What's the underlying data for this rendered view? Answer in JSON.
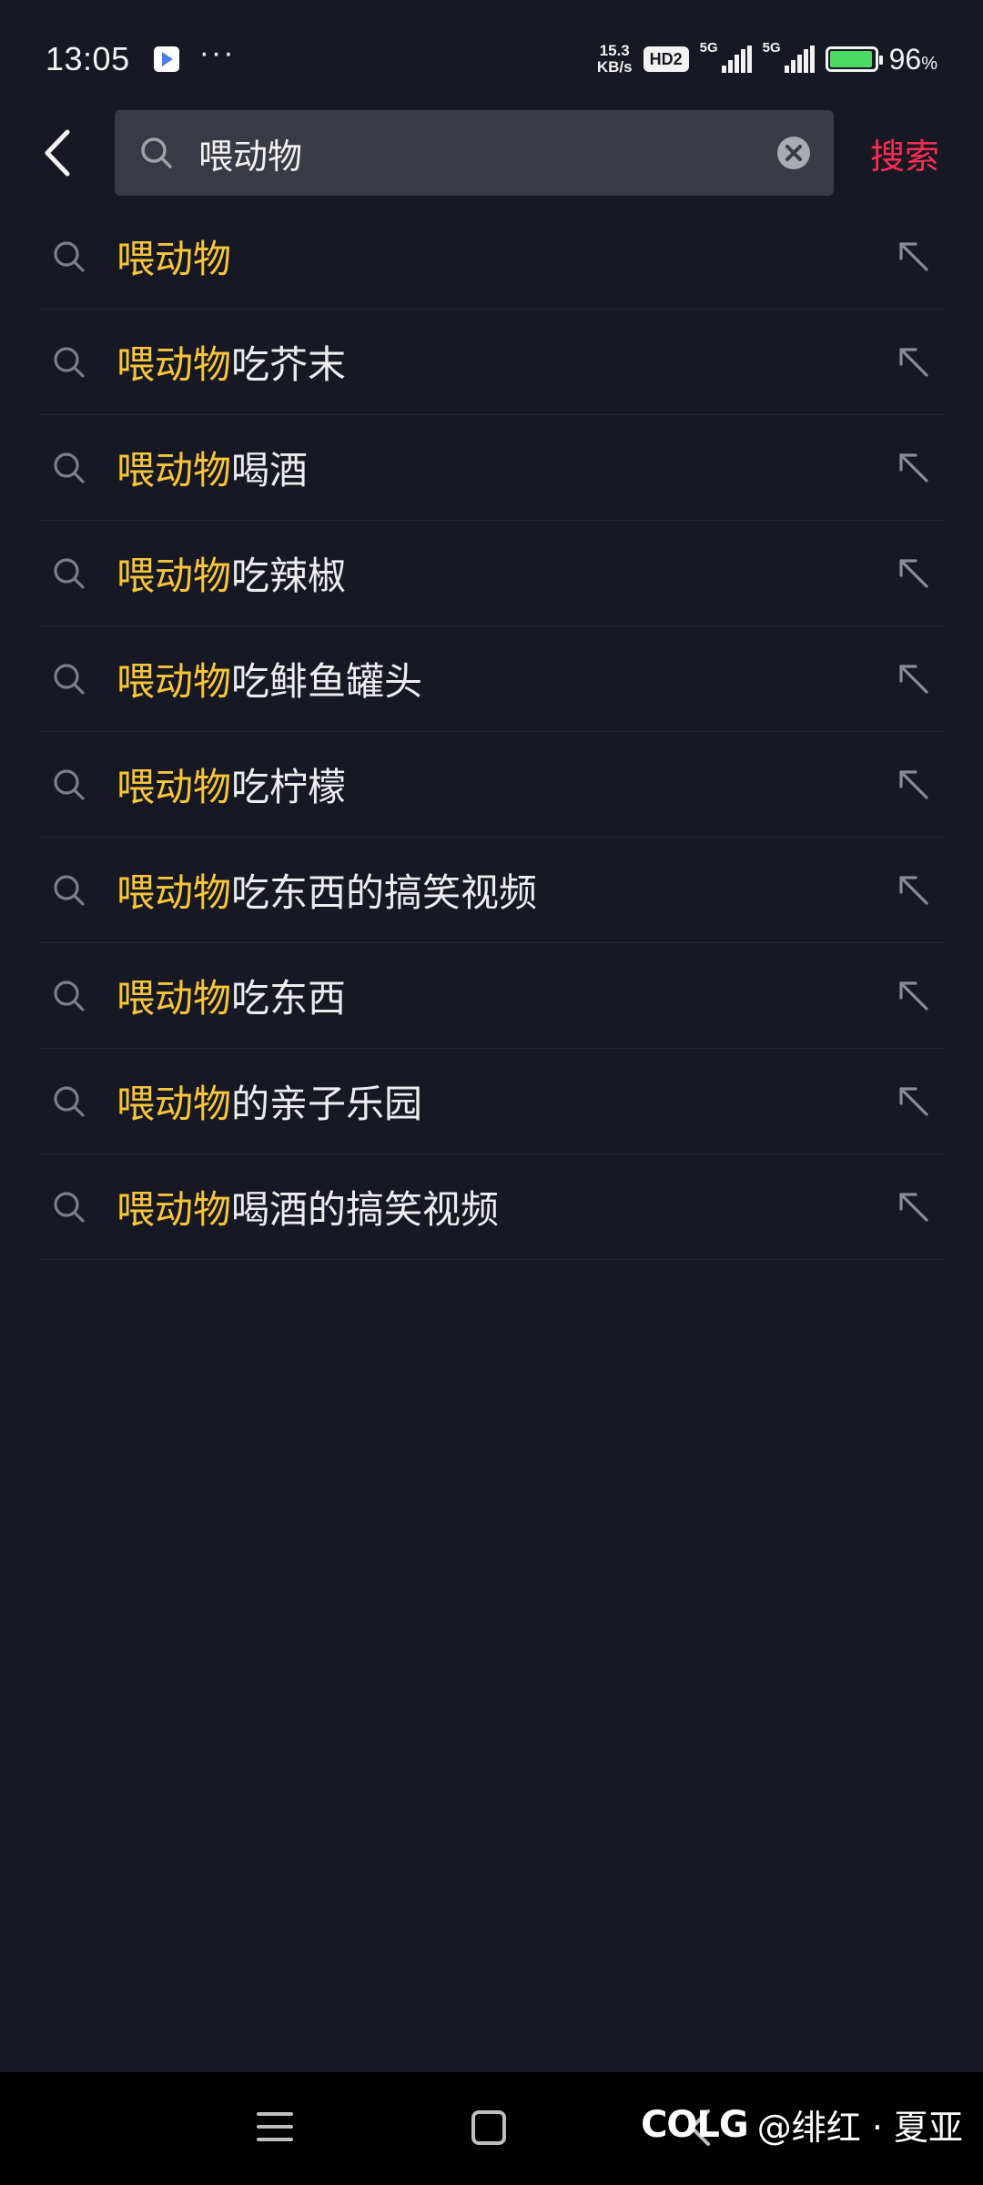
{
  "status_bar": {
    "time": "13:05",
    "more": "···",
    "net_speed_value": "15.3",
    "net_speed_unit": "KB/s",
    "hd_badge": "HD2",
    "signal_tag_1": "5G",
    "signal_tag_2": "5G",
    "battery_percent": "96",
    "battery_unit": "%",
    "battery_level": 0.96,
    "icons": [
      "app-store-icon",
      "wifi-speed",
      "hd-voice-icon",
      "signal-5g-icon",
      "signal-5g-icon",
      "battery-charging-icon"
    ]
  },
  "search": {
    "query": "喂动物",
    "submit_label": "搜索",
    "icons": {
      "back": "chevron-left-icon",
      "search": "search-icon",
      "clear": "clear-circle-icon"
    }
  },
  "suggestions": [
    {
      "highlight": "喂动物",
      "rest": ""
    },
    {
      "highlight": "喂动物",
      "rest": "吃芥末"
    },
    {
      "highlight": "喂动物",
      "rest": "喝酒"
    },
    {
      "highlight": "喂动物",
      "rest": "吃辣椒"
    },
    {
      "highlight": "喂动物",
      "rest": "吃鲱鱼罐头"
    },
    {
      "highlight": "喂动物",
      "rest": "吃柠檬"
    },
    {
      "highlight": "喂动物",
      "rest": "吃东西的搞笑视频"
    },
    {
      "highlight": "喂动物",
      "rest": "吃东西"
    },
    {
      "highlight": "喂动物",
      "rest": "的亲子乐园"
    },
    {
      "highlight": "喂动物",
      "rest": "喝酒的搞笑视频"
    }
  ],
  "nav_bar": {
    "icons": [
      "menu-icon",
      "home-icon",
      "back-icon"
    ]
  },
  "watermark": {
    "logo": "COLG",
    "text": "@绯红 · 夏亚"
  },
  "colors": {
    "background": "#161823",
    "search_box": "#393b44",
    "highlight": "#f8c53a",
    "accent": "#fe2c55",
    "nav_bar": "#000000"
  }
}
